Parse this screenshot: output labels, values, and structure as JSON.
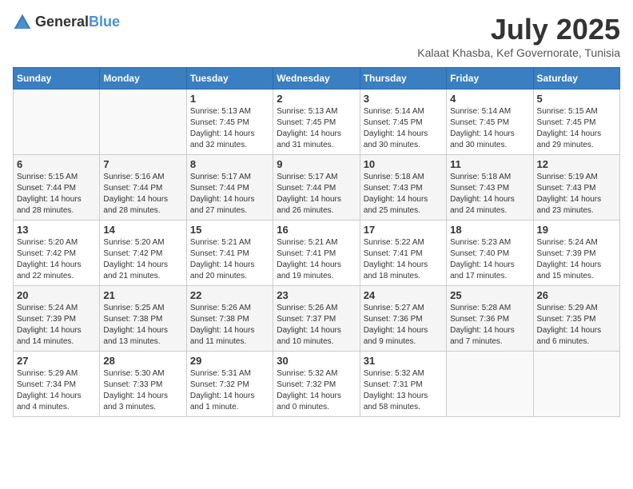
{
  "logo": {
    "general": "General",
    "blue": "Blue"
  },
  "header": {
    "month": "July 2025",
    "location": "Kalaat Khasba, Kef Governorate, Tunisia"
  },
  "weekdays": [
    "Sunday",
    "Monday",
    "Tuesday",
    "Wednesday",
    "Thursday",
    "Friday",
    "Saturday"
  ],
  "weeks": [
    [
      {
        "day": "",
        "empty": true
      },
      {
        "day": "",
        "empty": true
      },
      {
        "day": "1",
        "sunrise": "5:13 AM",
        "sunset": "7:45 PM",
        "daylight": "14 hours and 32 minutes."
      },
      {
        "day": "2",
        "sunrise": "5:13 AM",
        "sunset": "7:45 PM",
        "daylight": "14 hours and 31 minutes."
      },
      {
        "day": "3",
        "sunrise": "5:14 AM",
        "sunset": "7:45 PM",
        "daylight": "14 hours and 30 minutes."
      },
      {
        "day": "4",
        "sunrise": "5:14 AM",
        "sunset": "7:45 PM",
        "daylight": "14 hours and 30 minutes."
      },
      {
        "day": "5",
        "sunrise": "5:15 AM",
        "sunset": "7:45 PM",
        "daylight": "14 hours and 29 minutes."
      }
    ],
    [
      {
        "day": "6",
        "sunrise": "5:15 AM",
        "sunset": "7:44 PM",
        "daylight": "14 hours and 28 minutes."
      },
      {
        "day": "7",
        "sunrise": "5:16 AM",
        "sunset": "7:44 PM",
        "daylight": "14 hours and 28 minutes."
      },
      {
        "day": "8",
        "sunrise": "5:17 AM",
        "sunset": "7:44 PM",
        "daylight": "14 hours and 27 minutes."
      },
      {
        "day": "9",
        "sunrise": "5:17 AM",
        "sunset": "7:44 PM",
        "daylight": "14 hours and 26 minutes."
      },
      {
        "day": "10",
        "sunrise": "5:18 AM",
        "sunset": "7:43 PM",
        "daylight": "14 hours and 25 minutes."
      },
      {
        "day": "11",
        "sunrise": "5:18 AM",
        "sunset": "7:43 PM",
        "daylight": "14 hours and 24 minutes."
      },
      {
        "day": "12",
        "sunrise": "5:19 AM",
        "sunset": "7:43 PM",
        "daylight": "14 hours and 23 minutes."
      }
    ],
    [
      {
        "day": "13",
        "sunrise": "5:20 AM",
        "sunset": "7:42 PM",
        "daylight": "14 hours and 22 minutes."
      },
      {
        "day": "14",
        "sunrise": "5:20 AM",
        "sunset": "7:42 PM",
        "daylight": "14 hours and 21 minutes."
      },
      {
        "day": "15",
        "sunrise": "5:21 AM",
        "sunset": "7:41 PM",
        "daylight": "14 hours and 20 minutes."
      },
      {
        "day": "16",
        "sunrise": "5:21 AM",
        "sunset": "7:41 PM",
        "daylight": "14 hours and 19 minutes."
      },
      {
        "day": "17",
        "sunrise": "5:22 AM",
        "sunset": "7:41 PM",
        "daylight": "14 hours and 18 minutes."
      },
      {
        "day": "18",
        "sunrise": "5:23 AM",
        "sunset": "7:40 PM",
        "daylight": "14 hours and 17 minutes."
      },
      {
        "day": "19",
        "sunrise": "5:24 AM",
        "sunset": "7:39 PM",
        "daylight": "14 hours and 15 minutes."
      }
    ],
    [
      {
        "day": "20",
        "sunrise": "5:24 AM",
        "sunset": "7:39 PM",
        "daylight": "14 hours and 14 minutes."
      },
      {
        "day": "21",
        "sunrise": "5:25 AM",
        "sunset": "7:38 PM",
        "daylight": "14 hours and 13 minutes."
      },
      {
        "day": "22",
        "sunrise": "5:26 AM",
        "sunset": "7:38 PM",
        "daylight": "14 hours and 11 minutes."
      },
      {
        "day": "23",
        "sunrise": "5:26 AM",
        "sunset": "7:37 PM",
        "daylight": "14 hours and 10 minutes."
      },
      {
        "day": "24",
        "sunrise": "5:27 AM",
        "sunset": "7:36 PM",
        "daylight": "14 hours and 9 minutes."
      },
      {
        "day": "25",
        "sunrise": "5:28 AM",
        "sunset": "7:36 PM",
        "daylight": "14 hours and 7 minutes."
      },
      {
        "day": "26",
        "sunrise": "5:29 AM",
        "sunset": "7:35 PM",
        "daylight": "14 hours and 6 minutes."
      }
    ],
    [
      {
        "day": "27",
        "sunrise": "5:29 AM",
        "sunset": "7:34 PM",
        "daylight": "14 hours and 4 minutes."
      },
      {
        "day": "28",
        "sunrise": "5:30 AM",
        "sunset": "7:33 PM",
        "daylight": "14 hours and 3 minutes."
      },
      {
        "day": "29",
        "sunrise": "5:31 AM",
        "sunset": "7:32 PM",
        "daylight": "14 hours and 1 minute."
      },
      {
        "day": "30",
        "sunrise": "5:32 AM",
        "sunset": "7:32 PM",
        "daylight": "14 hours and 0 minutes."
      },
      {
        "day": "31",
        "sunrise": "5:32 AM",
        "sunset": "7:31 PM",
        "daylight": "13 hours and 58 minutes."
      },
      {
        "day": "",
        "empty": true
      },
      {
        "day": "",
        "empty": true
      }
    ]
  ]
}
